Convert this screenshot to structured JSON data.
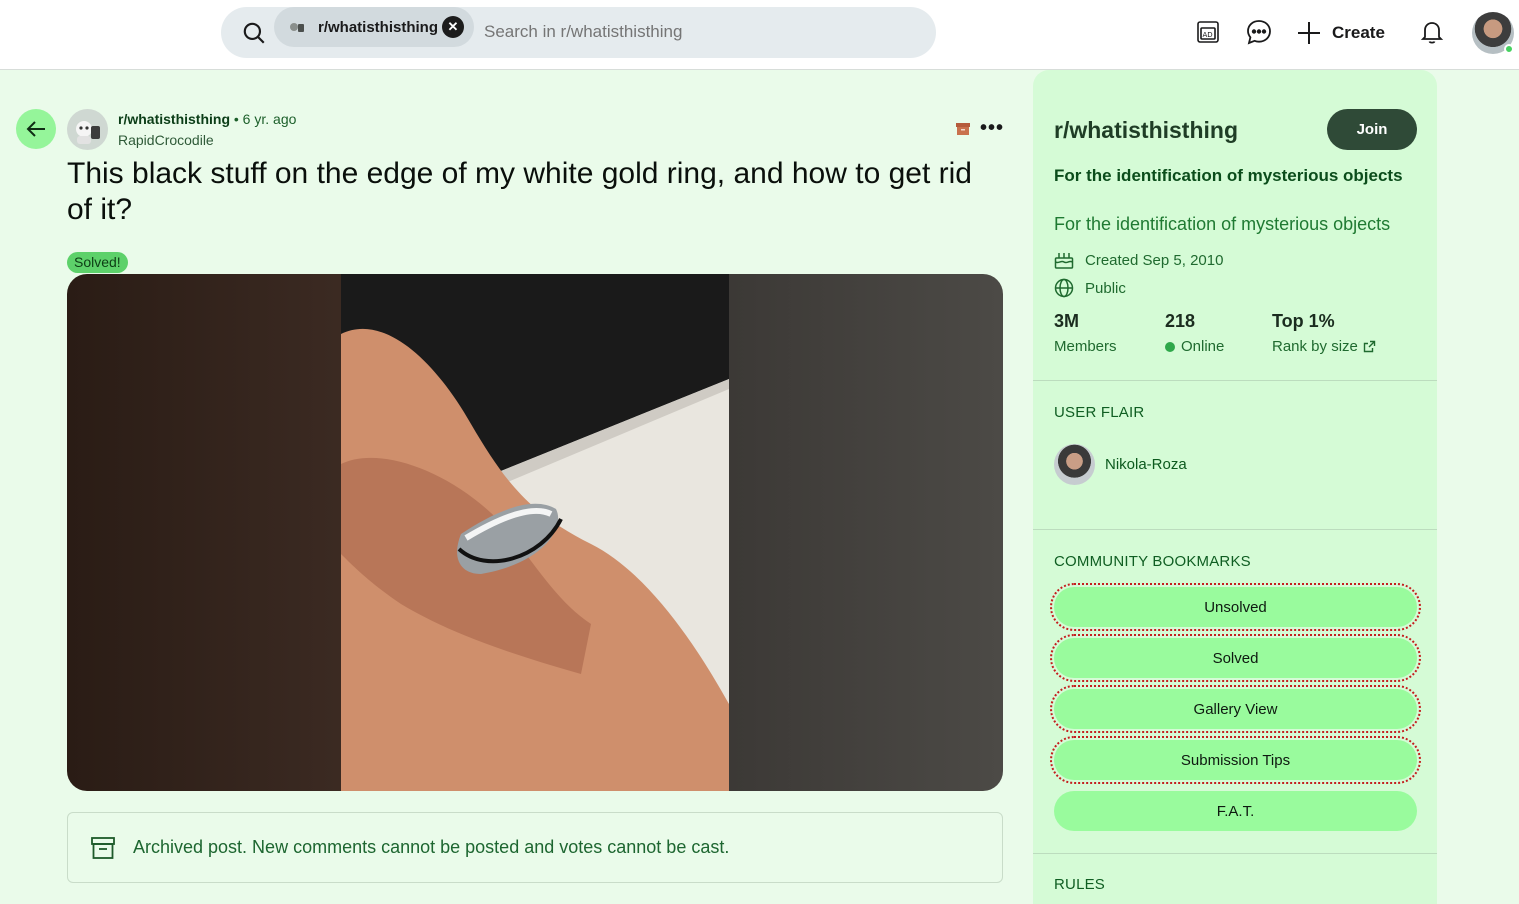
{
  "header": {
    "search_chip_label": "r/whatisthisthing",
    "search_placeholder": "Search in r/whatisthisthing",
    "create_label": "Create",
    "icons": [
      "search-icon",
      "ad-icon",
      "chat-icon",
      "plus-icon",
      "bell-icon"
    ]
  },
  "post": {
    "subreddit": "r/whatisthisthing",
    "age": "• 6 yr. ago",
    "author": "RapidCrocodile",
    "title": "This black stuff on the edge of my white gold ring, and how to get rid of it?",
    "flair": "Solved!",
    "archived_notice": "Archived post. New comments cannot be posted and votes cannot be cast."
  },
  "sidebar": {
    "title": "r/whatisthisthing",
    "join_label": "Join",
    "heading": "For the identification of mysterious objects",
    "description": "For the identification of mysterious objects",
    "created": "Created Sep 5, 2010",
    "visibility": "Public",
    "stats": [
      {
        "num": "3M",
        "label": "Members"
      },
      {
        "num": "218",
        "label": "Online"
      },
      {
        "num": "Top 1%",
        "label": "Rank by size"
      }
    ],
    "user_flair_label": "USER FLAIR",
    "user_flair_name": "Nikola-Roza",
    "bookmarks_label": "COMMUNITY BOOKMARKS",
    "bookmarks": [
      "Unsolved",
      "Solved",
      "Gallery View",
      "Submission Tips",
      "F.A.T."
    ],
    "rules_label": "RULES"
  },
  "colors": {
    "page_bg": "#eafbea",
    "sidebar_bg": "#d5fbd6",
    "accent_green": "#99fb9d",
    "join_bg": "#2f4a37",
    "flair_bg": "#5dd16a"
  }
}
